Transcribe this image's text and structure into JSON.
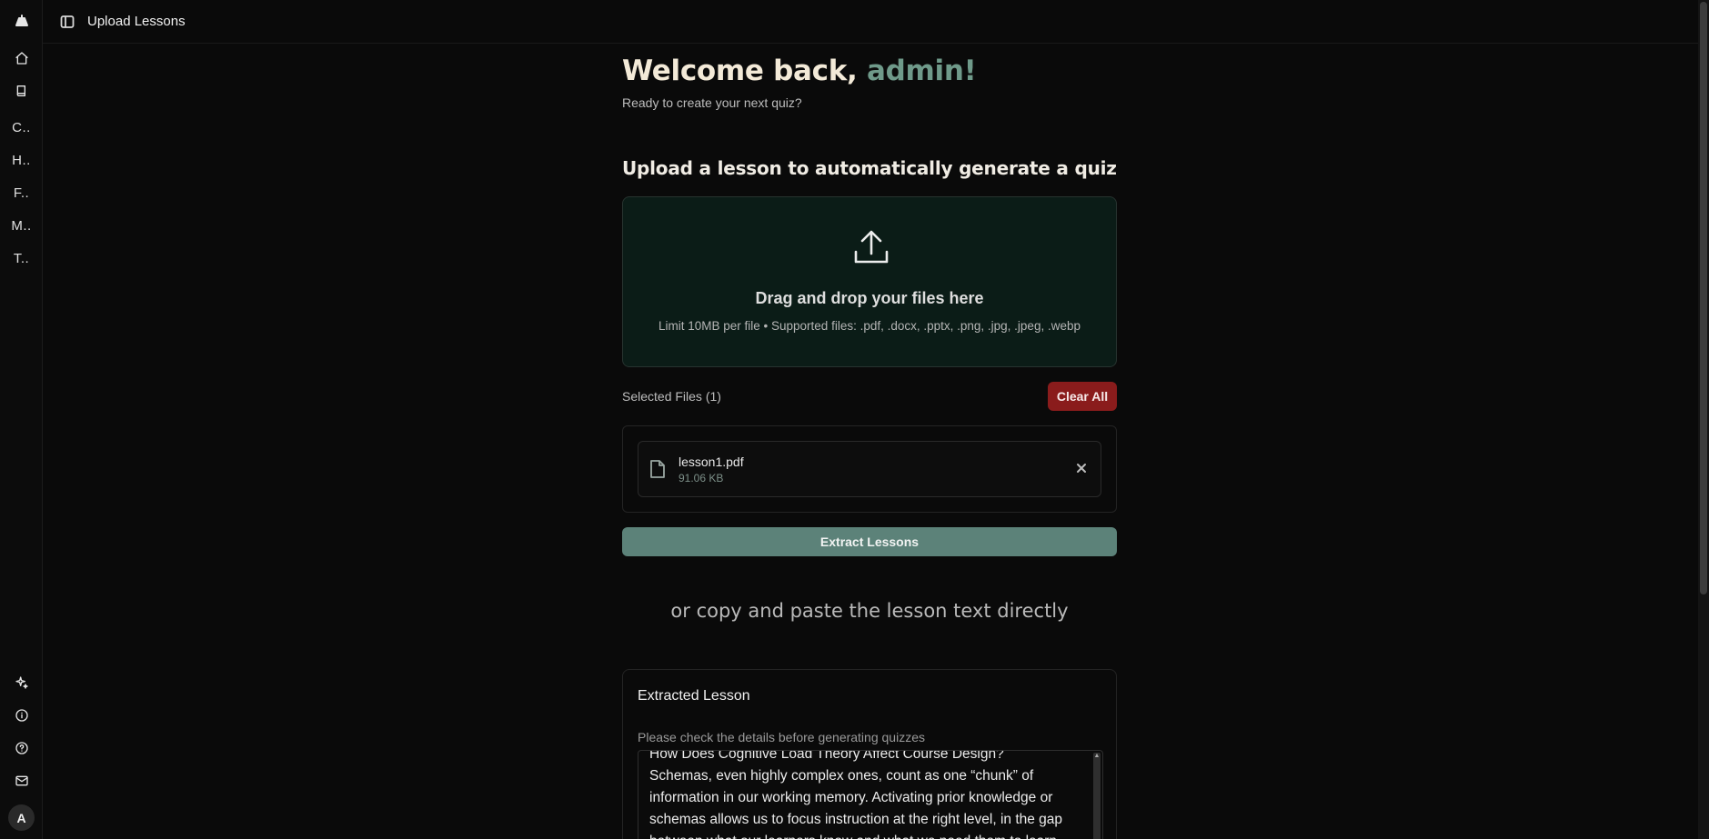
{
  "header": {
    "title": "Upload Lessons"
  },
  "sidebar": {
    "items": [
      {
        "label": "C.."
      },
      {
        "label": "H.."
      },
      {
        "label": "F.."
      },
      {
        "label": "M.."
      },
      {
        "label": "T.."
      }
    ],
    "avatar_initial": "A"
  },
  "main": {
    "welcome_prefix": "Welcome back,",
    "welcome_name": "admin!",
    "subtitle": "Ready to create your next quiz?",
    "section_title": "Upload a lesson to automatically generate a quiz",
    "dropzone": {
      "title": "Drag and drop your files here",
      "hint": "Limit 10MB per file • Supported files: .pdf, .docx, .pptx, .png, .jpg, .jpeg, .webp"
    },
    "selected_files_label": "Selected Files (1)",
    "clear_all_label": "Clear All",
    "files": [
      {
        "name": "lesson1.pdf",
        "size": "91.06 KB"
      }
    ],
    "extract_button_label": "Extract Lessons",
    "or_copy_label": "or copy and paste the lesson text directly",
    "extracted": {
      "title": "Extracted Lesson",
      "hint": "Please check the details before generating quizzes",
      "text": "How Does Cognitive Load Theory Affect Course Design?\nSchemas, even highly complex ones, count as one “chunk” of information in our working memory. Activating prior knowledge or schemas allows us to focus instruction at the right level, in the gap between what our learners know and what we need them to learn."
    }
  },
  "colors": {
    "accent": "#6f9a8a",
    "danger": "#8a1c1c",
    "primary_button": "#5c8279",
    "dropzone_bg": "#0b1c17"
  }
}
